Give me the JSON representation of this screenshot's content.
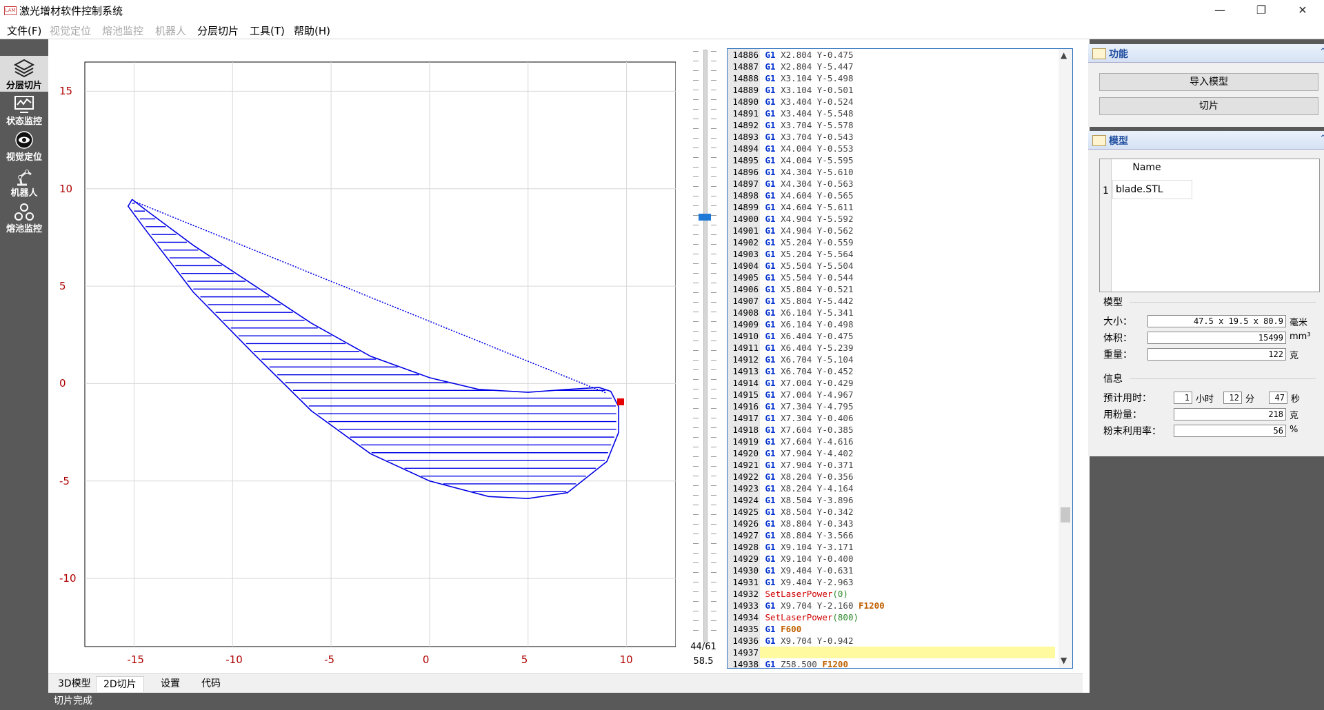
{
  "window": {
    "title": "激光增材软件控制系统",
    "icon_text": "LAM",
    "controls": {
      "minimize": "—",
      "restore": "❐",
      "close": "✕"
    }
  },
  "menu": {
    "items": [
      {
        "label": "文件(F)",
        "enabled": true
      },
      {
        "label": "视觉定位",
        "enabled": false
      },
      {
        "label": "熔池监控",
        "enabled": false
      },
      {
        "label": "机器人",
        "enabled": false
      },
      {
        "label": "分层切片",
        "enabled": true
      },
      {
        "label": "工具(T)",
        "enabled": true
      },
      {
        "label": "帮助(H)",
        "enabled": true
      }
    ]
  },
  "sidebar": {
    "items": [
      {
        "label": "分层切片",
        "icon": "layers-icon",
        "active": true
      },
      {
        "label": "状态监控",
        "icon": "monitor-chart-icon",
        "active": false
      },
      {
        "label": "视觉定位",
        "icon": "eye-icon",
        "active": false
      },
      {
        "label": "机器人",
        "icon": "robot-arm-icon",
        "active": false
      },
      {
        "label": "熔池监控",
        "icon": "pool-monitor-icon",
        "active": false
      }
    ]
  },
  "plot": {
    "x_ticks": [
      "-15",
      "-10",
      "-5",
      "0",
      "5",
      "10"
    ],
    "y_ticks": [
      "15",
      "10",
      "5",
      "0",
      "-5",
      "-10"
    ],
    "xlim": [
      -17.5,
      12.5
    ],
    "ylim": [
      -13.5,
      16.5
    ],
    "line_color": "#0000e6",
    "marker_color": "#e60000"
  },
  "chart_data": {
    "type": "line",
    "xlim": [
      -17.5,
      12.5
    ],
    "ylim": [
      -13.5,
      16.5
    ],
    "x_ticks": [
      -15,
      -10,
      -5,
      0,
      5,
      10
    ],
    "y_ticks": [
      -10,
      -5,
      0,
      5,
      10,
      15
    ],
    "grid": true,
    "series": [
      {
        "role": "outline",
        "points": [
          [
            -15.1,
            9.45
          ],
          [
            -14.4,
            8.9
          ],
          [
            -12.0,
            7.1
          ],
          [
            -9.0,
            5.1
          ],
          [
            -6.0,
            3.1
          ],
          [
            -3.0,
            1.4
          ],
          [
            0.0,
            0.3
          ],
          [
            2.5,
            -0.3
          ],
          [
            5.0,
            -0.45
          ],
          [
            7.0,
            -0.3
          ],
          [
            8.6,
            -0.2
          ],
          [
            9.2,
            -0.4
          ],
          [
            9.6,
            -1.2
          ],
          [
            9.6,
            -2.5
          ],
          [
            9.0,
            -4.0
          ],
          [
            7.0,
            -5.6
          ],
          [
            5.0,
            -5.9
          ],
          [
            3.0,
            -5.8
          ],
          [
            0.0,
            -5.0
          ],
          [
            -3.0,
            -3.6
          ],
          [
            -6.0,
            -1.4
          ],
          [
            -9.0,
            1.6
          ],
          [
            -12.0,
            4.7
          ],
          [
            -14.5,
            8.0
          ],
          [
            -15.3,
            9.1
          ],
          [
            -15.1,
            9.45
          ]
        ]
      },
      {
        "role": "rapid-move",
        "style": "dotted",
        "points": [
          [
            -15.0,
            9.35
          ],
          [
            9.0,
            -0.5
          ]
        ]
      }
    ],
    "hatch_spacing": 0.4,
    "marker": [
      9.7,
      -0.94
    ]
  },
  "slider": {
    "layer_value": "44/61",
    "height_value": "58.5",
    "thumb_fraction": 0.72
  },
  "code": {
    "lines": [
      {
        "n": "14886",
        "cmd": "G1",
        "args": "X2.804 Y-0.475"
      },
      {
        "n": "14887",
        "cmd": "G1",
        "args": "X2.804 Y-5.447"
      },
      {
        "n": "14888",
        "cmd": "G1",
        "args": "X3.104 Y-5.498"
      },
      {
        "n": "14889",
        "cmd": "G1",
        "args": "X3.104 Y-0.501"
      },
      {
        "n": "14890",
        "cmd": "G1",
        "args": "X3.404 Y-0.524"
      },
      {
        "n": "14891",
        "cmd": "G1",
        "args": "X3.404 Y-5.548"
      },
      {
        "n": "14892",
        "cmd": "G1",
        "args": "X3.704 Y-5.578"
      },
      {
        "n": "14893",
        "cmd": "G1",
        "args": "X3.704 Y-0.543"
      },
      {
        "n": "14894",
        "cmd": "G1",
        "args": "X4.004 Y-0.553"
      },
      {
        "n": "14895",
        "cmd": "G1",
        "args": "X4.004 Y-5.595"
      },
      {
        "n": "14896",
        "cmd": "G1",
        "args": "X4.304 Y-5.610"
      },
      {
        "n": "14897",
        "cmd": "G1",
        "args": "X4.304 Y-0.563"
      },
      {
        "n": "14898",
        "cmd": "G1",
        "args": "X4.604 Y-0.565"
      },
      {
        "n": "14899",
        "cmd": "G1",
        "args": "X4.604 Y-5.611"
      },
      {
        "n": "14900",
        "cmd": "G1",
        "args": "X4.904 Y-5.592"
      },
      {
        "n": "14901",
        "cmd": "G1",
        "args": "X4.904 Y-0.562"
      },
      {
        "n": "14902",
        "cmd": "G1",
        "args": "X5.204 Y-0.559"
      },
      {
        "n": "14903",
        "cmd": "G1",
        "args": "X5.204 Y-5.564"
      },
      {
        "n": "14904",
        "cmd": "G1",
        "args": "X5.504 Y-5.504"
      },
      {
        "n": "14905",
        "cmd": "G1",
        "args": "X5.504 Y-0.544"
      },
      {
        "n": "14906",
        "cmd": "G1",
        "args": "X5.804 Y-0.521"
      },
      {
        "n": "14907",
        "cmd": "G1",
        "args": "X5.804 Y-5.442"
      },
      {
        "n": "14908",
        "cmd": "G1",
        "args": "X6.104 Y-5.341"
      },
      {
        "n": "14909",
        "cmd": "G1",
        "args": "X6.104 Y-0.498"
      },
      {
        "n": "14910",
        "cmd": "G1",
        "args": "X6.404 Y-0.475"
      },
      {
        "n": "14911",
        "cmd": "G1",
        "args": "X6.404 Y-5.239"
      },
      {
        "n": "14912",
        "cmd": "G1",
        "args": "X6.704 Y-5.104"
      },
      {
        "n": "14913",
        "cmd": "G1",
        "args": "X6.704 Y-0.452"
      },
      {
        "n": "14914",
        "cmd": "G1",
        "args": "X7.004 Y-0.429"
      },
      {
        "n": "14915",
        "cmd": "G1",
        "args": "X7.004 Y-4.967"
      },
      {
        "n": "14916",
        "cmd": "G1",
        "args": "X7.304 Y-4.795"
      },
      {
        "n": "14917",
        "cmd": "G1",
        "args": "X7.304 Y-0.406"
      },
      {
        "n": "14918",
        "cmd": "G1",
        "args": "X7.604 Y-0.385"
      },
      {
        "n": "14919",
        "cmd": "G1",
        "args": "X7.604 Y-4.616"
      },
      {
        "n": "14920",
        "cmd": "G1",
        "args": "X7.904 Y-4.402"
      },
      {
        "n": "14921",
        "cmd": "G1",
        "args": "X7.904 Y-0.371"
      },
      {
        "n": "14922",
        "cmd": "G1",
        "args": "X8.204 Y-0.356"
      },
      {
        "n": "14923",
        "cmd": "G1",
        "args": "X8.204 Y-4.164"
      },
      {
        "n": "14924",
        "cmd": "G1",
        "args": "X8.504 Y-3.896"
      },
      {
        "n": "14925",
        "cmd": "G1",
        "args": "X8.504 Y-0.342"
      },
      {
        "n": "14926",
        "cmd": "G1",
        "args": "X8.804 Y-0.343"
      },
      {
        "n": "14927",
        "cmd": "G1",
        "args": "X8.804 Y-3.566"
      },
      {
        "n": "14928",
        "cmd": "G1",
        "args": "X9.104 Y-3.171"
      },
      {
        "n": "14929",
        "cmd": "G1",
        "args": "X9.104 Y-0.400"
      },
      {
        "n": "14930",
        "cmd": "G1",
        "args": "X9.404 Y-0.631"
      },
      {
        "n": "14931",
        "cmd": "G1",
        "args": "X9.404 Y-2.963"
      },
      {
        "n": "14932",
        "fn": "SetLaserPower",
        "arg": "(0)"
      },
      {
        "n": "14933",
        "cmd": "G1",
        "args": "X9.704 Y-2.160",
        "feed": "F1200"
      },
      {
        "n": "14934",
        "fn": "SetLaserPower",
        "arg": "(800)"
      },
      {
        "n": "14935",
        "cmd": "G1",
        "args": "",
        "feed": "F600"
      },
      {
        "n": "14936",
        "cmd": "G1",
        "args": "X9.704 Y-0.942"
      },
      {
        "n": "14937",
        "cmd": "",
        "args": "",
        "highlight": true
      },
      {
        "n": "14938",
        "cmd": "G1",
        "args": "Z58.500",
        "feed": "F1200"
      }
    ]
  },
  "tabs": {
    "items": [
      {
        "label": "3D模型",
        "active": false
      },
      {
        "label": "2D切片",
        "active": true
      },
      {
        "label": "设置",
        "active": false
      },
      {
        "label": "代码",
        "active": false
      }
    ]
  },
  "status": {
    "text": "切片完成"
  },
  "function_box": {
    "title": "功能",
    "import_button": "导入模型",
    "slice_button": "切片"
  },
  "model_box": {
    "title": "模型",
    "grid_header": "Name",
    "rows": [
      {
        "no": "1",
        "name": "blade.STL"
      }
    ],
    "model_section": "模型",
    "size_label": "大小：",
    "size_value": "47.5 x 19.5 x 80.9",
    "size_unit": "毫米",
    "volume_label": "体积：",
    "volume_value": "15499",
    "volume_unit": "mm³",
    "weight_label": "重量：",
    "weight_value": "122",
    "weight_unit": "克",
    "info_section": "信息",
    "time_label": "预计用时：",
    "hours": "1",
    "hours_unit": "小时",
    "minutes": "12",
    "minutes_unit": "分",
    "seconds": "47",
    "seconds_unit": "秒",
    "powder_label": "用粉量：",
    "powder_value": "218",
    "powder_unit": "克",
    "util_label": "粉末利用率：",
    "util_value": "56",
    "util_unit": "%"
  }
}
